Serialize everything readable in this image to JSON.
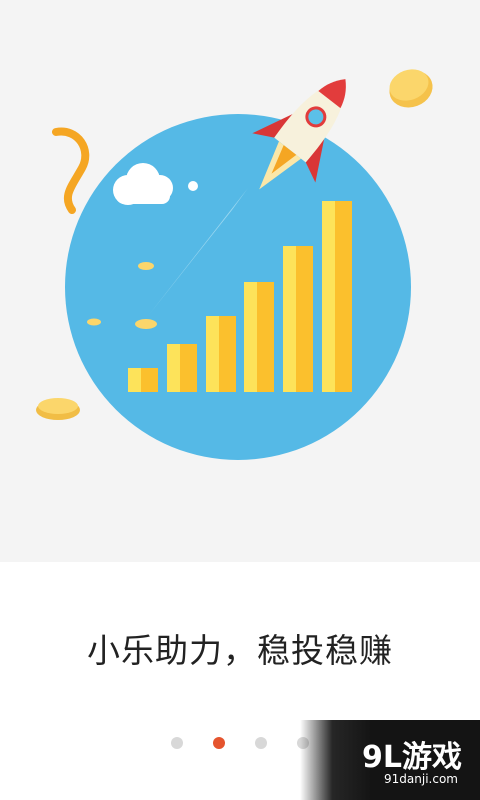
{
  "onboarding": {
    "slogan": "小乐助力，稳投稳赚",
    "page_indicator": {
      "total": 4,
      "active_index": 1
    },
    "illustration": {
      "subject": "rocket-over-growth-bars",
      "circle_color": "#4fb8e6",
      "bar_color": "#fdd835",
      "rocket_color": "#e23c3c"
    },
    "watermark": {
      "main": "9L游戏",
      "sub": "91danji.com"
    }
  }
}
